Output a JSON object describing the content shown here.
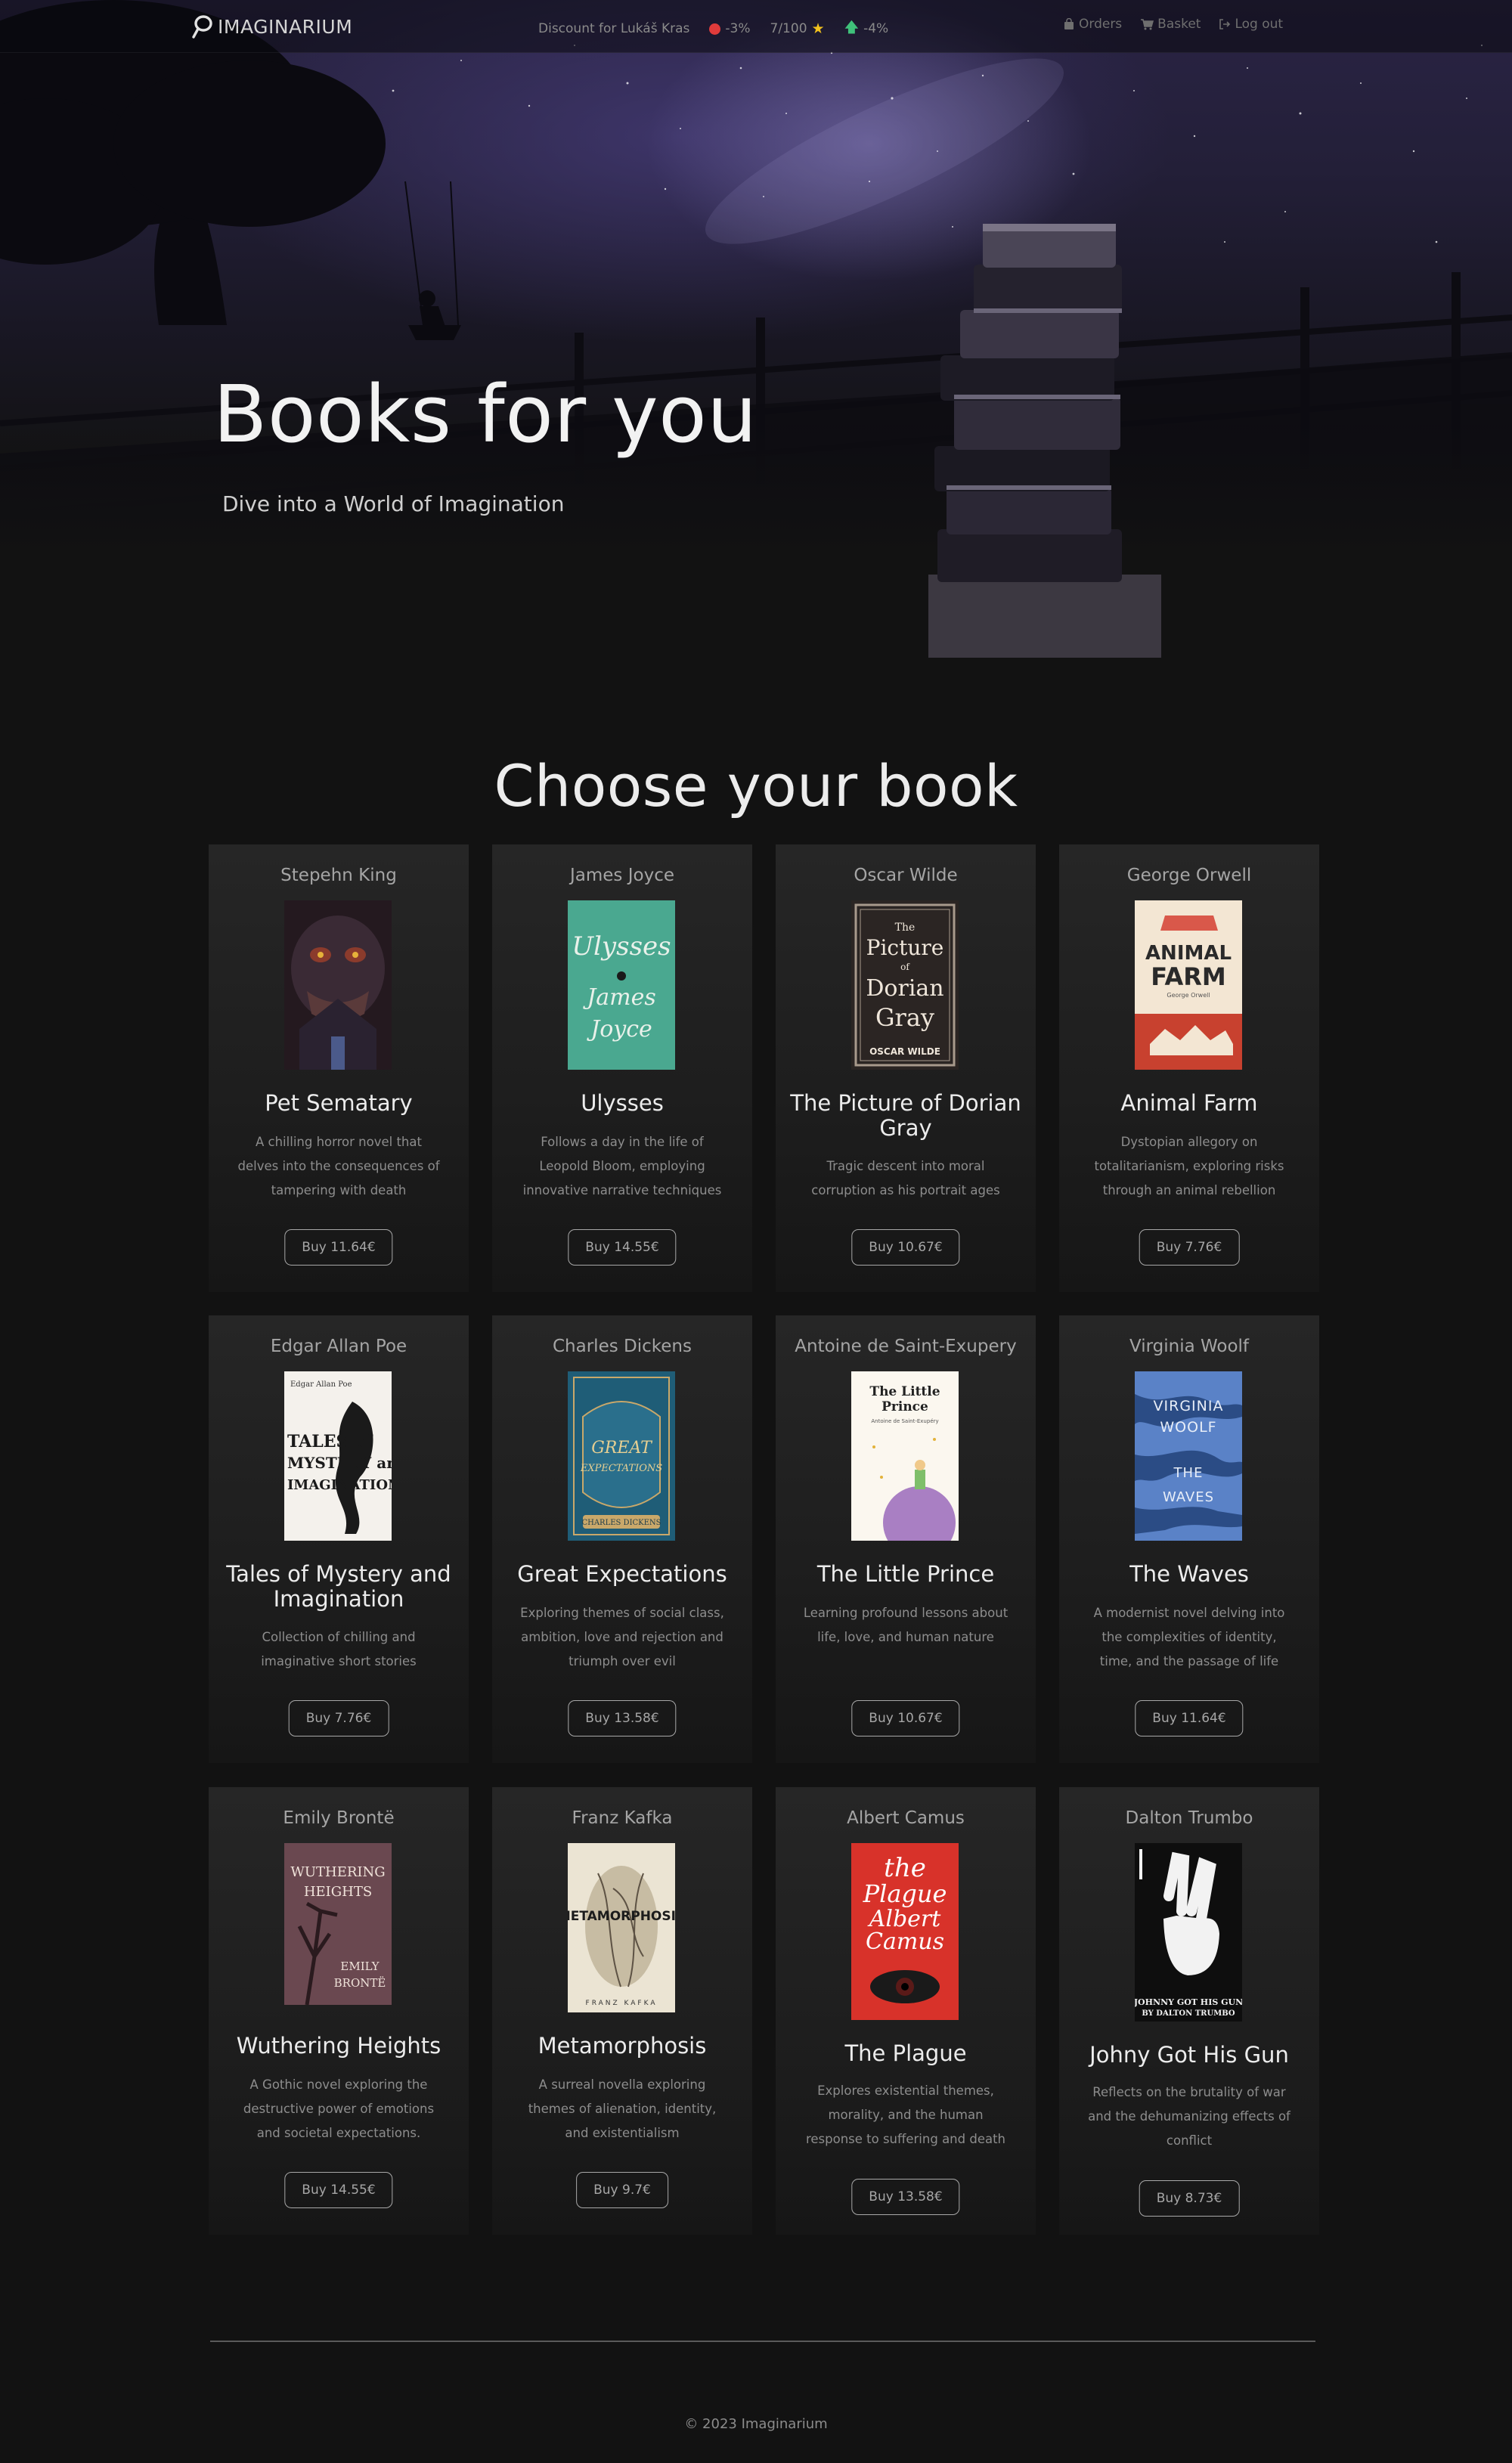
{
  "header": {
    "brand": "IMAGINARIUM",
    "discount_label": "Discount for Lukáš Kras",
    "discount_percent": "-3%",
    "rating": "7/100",
    "trend_percent": "-4%",
    "nav": {
      "orders": "Orders",
      "basket": "Basket",
      "logout": "Log out"
    },
    "colors": {
      "status_dot": "#e03b3b",
      "star": "#f2c21d",
      "trend_arrow": "#3fc17a"
    }
  },
  "hero": {
    "title": "Books for you",
    "subtitle": "Dive into a World of Imagination"
  },
  "catalog": {
    "title": "Choose your book",
    "books": [
      {
        "author": "Stepehn King",
        "title": "Pet Sematary",
        "description": "A chilling horror novel that delves into the consequences of tampering with death",
        "price_label": "Buy 11.64€"
      },
      {
        "author": "James Joyce",
        "title": "Ulysses",
        "description": "Follows a day in the life of Leopold Bloom, employing innovative narrative techniques",
        "price_label": "Buy 14.55€"
      },
      {
        "author": "Oscar Wilde",
        "title": "The Picture of Dorian Gray",
        "description": "Tragic descent into moral corruption as his portrait ages",
        "price_label": "Buy 10.67€"
      },
      {
        "author": "George Orwell",
        "title": "Animal Farm",
        "description": "Dystopian allegory on totalitarianism, exploring risks through an animal rebellion",
        "price_label": "Buy 7.76€"
      },
      {
        "author": "Edgar Allan Poe",
        "title": "Tales of Mystery and Imagination",
        "description": "Collection of chilling and imaginative short stories",
        "price_label": "Buy 7.76€"
      },
      {
        "author": "Charles Dickens",
        "title": "Great Expectations",
        "description": "Exploring themes of social class, ambition, love and rejection and triumph over evil",
        "price_label": "Buy 13.58€"
      },
      {
        "author": "Antoine de Saint-Exupery",
        "title": "The Little Prince",
        "description": "Learning profound lessons about life, love, and human nature",
        "price_label": "Buy 10.67€"
      },
      {
        "author": "Virginia Woolf",
        "title": "The Waves",
        "description": "A modernist novel delving into the complexities of identity, time, and the passage of life",
        "price_label": "Buy 11.64€"
      },
      {
        "author": "Emily Brontë",
        "title": "Wuthering Heights",
        "description": "A Gothic novel exploring the destructive power of emotions and societal expectations.",
        "price_label": "Buy 14.55€"
      },
      {
        "author": "Franz Kafka",
        "title": "Metamorphosis",
        "description": "A surreal novella exploring themes of alienation, identity, and existentialism",
        "price_label": "Buy 9.7€"
      },
      {
        "author": "Albert Camus",
        "title": "The Plague",
        "description": "Explores existential themes, morality, and the human response to suffering and death",
        "price_label": "Buy 13.58€"
      },
      {
        "author": "Dalton Trumbo",
        "title": "Johny Got His Gun",
        "description": "Reflects on the brutality of war and the dehumanizing effects of conflict",
        "price_label": "Buy 8.73€"
      }
    ]
  },
  "covers": {
    "ulysses": {
      "line1": "Ulysses",
      "line2": "James",
      "line3": "Joyce"
    },
    "dorian": {
      "line1": "The",
      "line2": "Picture",
      "line3": "of",
      "line4": "Dorian",
      "line5": "Gray",
      "line6": "OSCAR WILDE"
    },
    "animal_farm": {
      "line1": "ANIMAL",
      "line2": "FARM",
      "line3": "George Orwell"
    },
    "poe": {
      "line1": "Edgar Allan Poe",
      "line2": "TALES of",
      "line3": "MYSTERY and",
      "line4": "IMAGINATION"
    },
    "dickens": {
      "line1": "GREAT",
      "line2": "EXPECTATIONS",
      "line3": "CHARLES DICKENS"
    },
    "little_prince": {
      "line1": "The Little",
      "line2": "Prince",
      "line3": "Antoine de Saint-Exupéry"
    },
    "waves": {
      "line1": "VIRGINIA",
      "line2": "WOOLF",
      "line3": "THE",
      "line4": "WAVES"
    },
    "wuthering": {
      "line1": "WUTHERING",
      "line2": "HEIGHTS",
      "line3": "EMILY",
      "line4": "BRONTË"
    },
    "metamorphosis": {
      "line1": "METAMORPHOSIS",
      "line2": "FRANZ KAFKA"
    },
    "plague": {
      "line1": "the",
      "line2": "Plague",
      "line3": "Albert",
      "line4": "Camus"
    },
    "trumbo": {
      "line1": "JOHNNY GOT HIS GUN",
      "line2": "BY DALTON TRUMBO"
    }
  },
  "footer": {
    "copyright": "© 2023 Imaginarium"
  }
}
